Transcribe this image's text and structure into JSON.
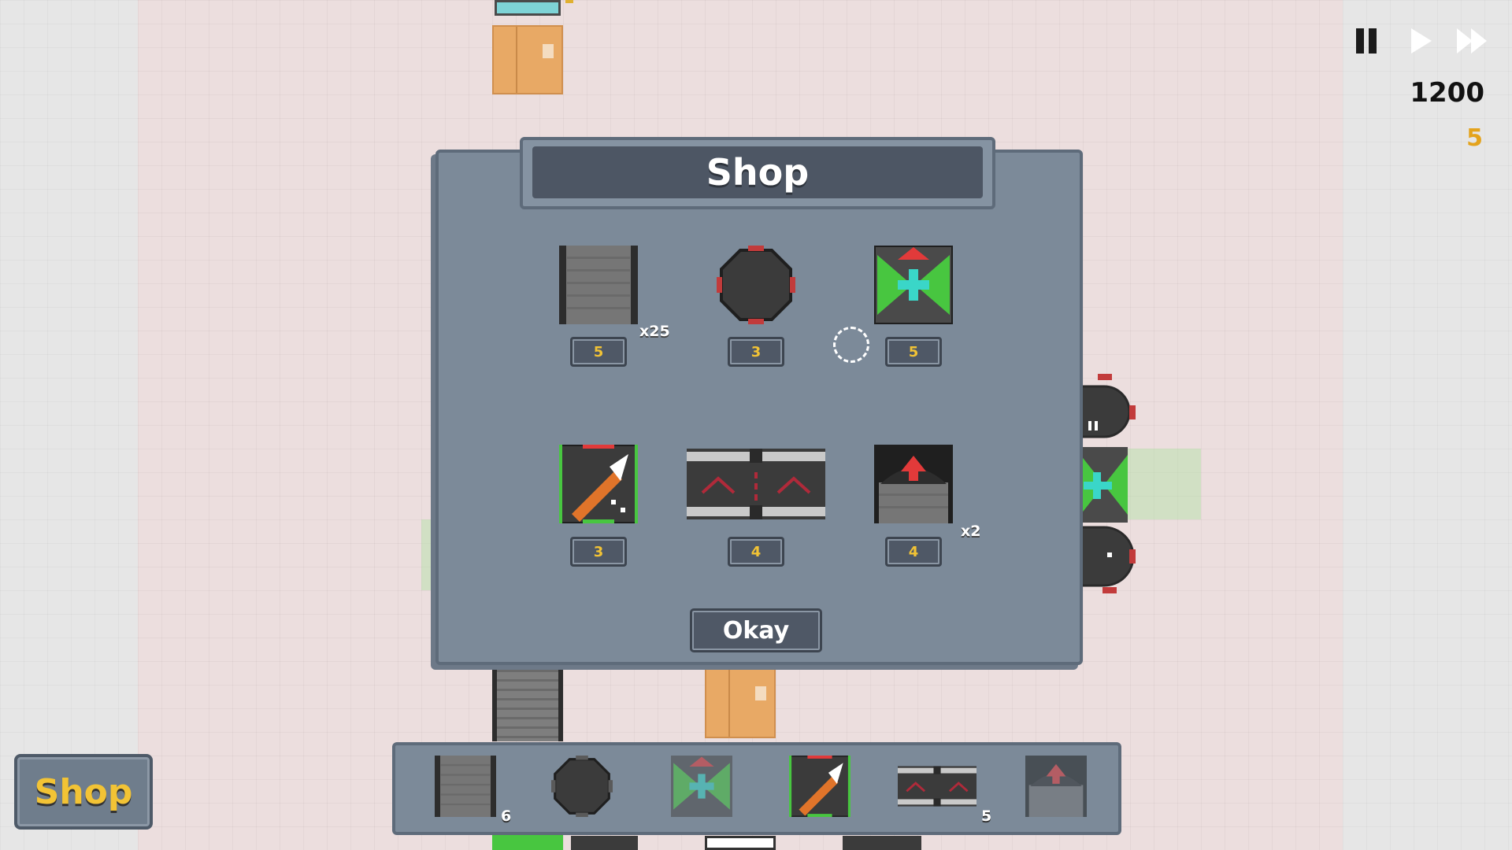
{
  "shop_modal": {
    "title": "Shop",
    "items": [
      {
        "name": "conveyor-belt",
        "price": "5",
        "multiplier": "x25"
      },
      {
        "name": "rotator",
        "price": "3",
        "multiplier": ""
      },
      {
        "name": "splitter",
        "price": "5",
        "multiplier": ""
      },
      {
        "name": "cutter",
        "price": "3",
        "multiplier": ""
      },
      {
        "name": "bridge",
        "price": "4",
        "multiplier": ""
      },
      {
        "name": "launcher",
        "price": "4",
        "multiplier": "x2"
      }
    ],
    "okay_label": "Okay"
  },
  "toolbar": {
    "items": [
      {
        "name": "conveyor-belt",
        "count": "6"
      },
      {
        "name": "rotator",
        "count": ""
      },
      {
        "name": "splitter",
        "count": ""
      },
      {
        "name": "cutter",
        "count": ""
      },
      {
        "name": "bridge",
        "count": "5"
      },
      {
        "name": "launcher",
        "count": ""
      }
    ]
  },
  "shop_button_label": "Shop",
  "hud": {
    "score": "1200",
    "coins": "5",
    "pause_icon": "pause-icon",
    "play_icon": "play-icon",
    "fast_forward_icon": "fast-forward-icon"
  },
  "colors": {
    "accent_gold": "#f2c335",
    "panel": "#7c8a99",
    "panel_dark": "#4d5664"
  }
}
